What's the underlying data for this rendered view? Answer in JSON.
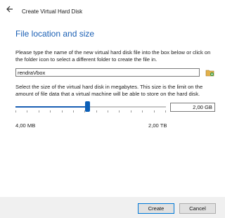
{
  "window": {
    "title": "Create Virtual Hard Disk"
  },
  "page": {
    "title": "File location and size",
    "location_description": "Please type the name of the new virtual hard disk file into the box below or click on the folder icon to select a different folder to create the file in.",
    "size_description": "Select the size of the virtual hard disk in megabytes. This size is the limit on the amount of file data that a virtual machine will be able to store on the hard disk."
  },
  "file_location": {
    "value": "rendraVbox"
  },
  "size": {
    "value": "2,00 GB",
    "min_label": "4,00 MB",
    "max_label": "2,00 TB",
    "slider_position": 0.48
  },
  "buttons": {
    "create": "Create",
    "cancel": "Cancel"
  },
  "icons": {
    "back": "back-arrow-icon",
    "folder": "folder-icon"
  },
  "colors": {
    "accent": "#1a5fb4",
    "slider_thumb": "#0b5fb8"
  }
}
